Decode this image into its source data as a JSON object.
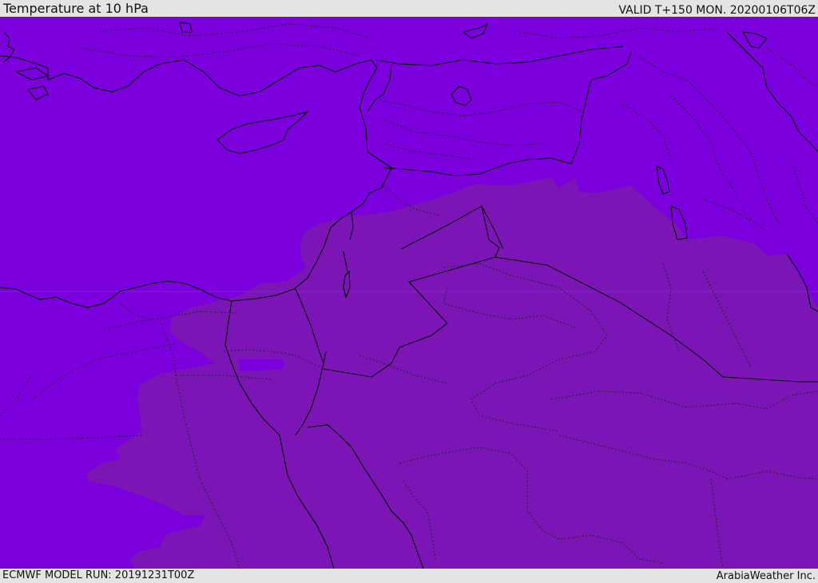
{
  "header": {
    "title": "Temperature at 10 hPa",
    "valid": "VALID T+150 MON. 20200106T06Z"
  },
  "footer": {
    "model_run": "ECMWF MODEL RUN: 20191231T00Z",
    "credit": "ArabiaWeather Inc."
  },
  "map": {
    "region": "Eastern Mediterranean and Arabian Peninsula",
    "layers": [
      "temperature-fill",
      "coastlines",
      "country-borders",
      "province-borders"
    ],
    "colors": {
      "cold_zone": "#7b00dd",
      "warm_zone": "#7b15b5",
      "line": "#000000"
    }
  }
}
